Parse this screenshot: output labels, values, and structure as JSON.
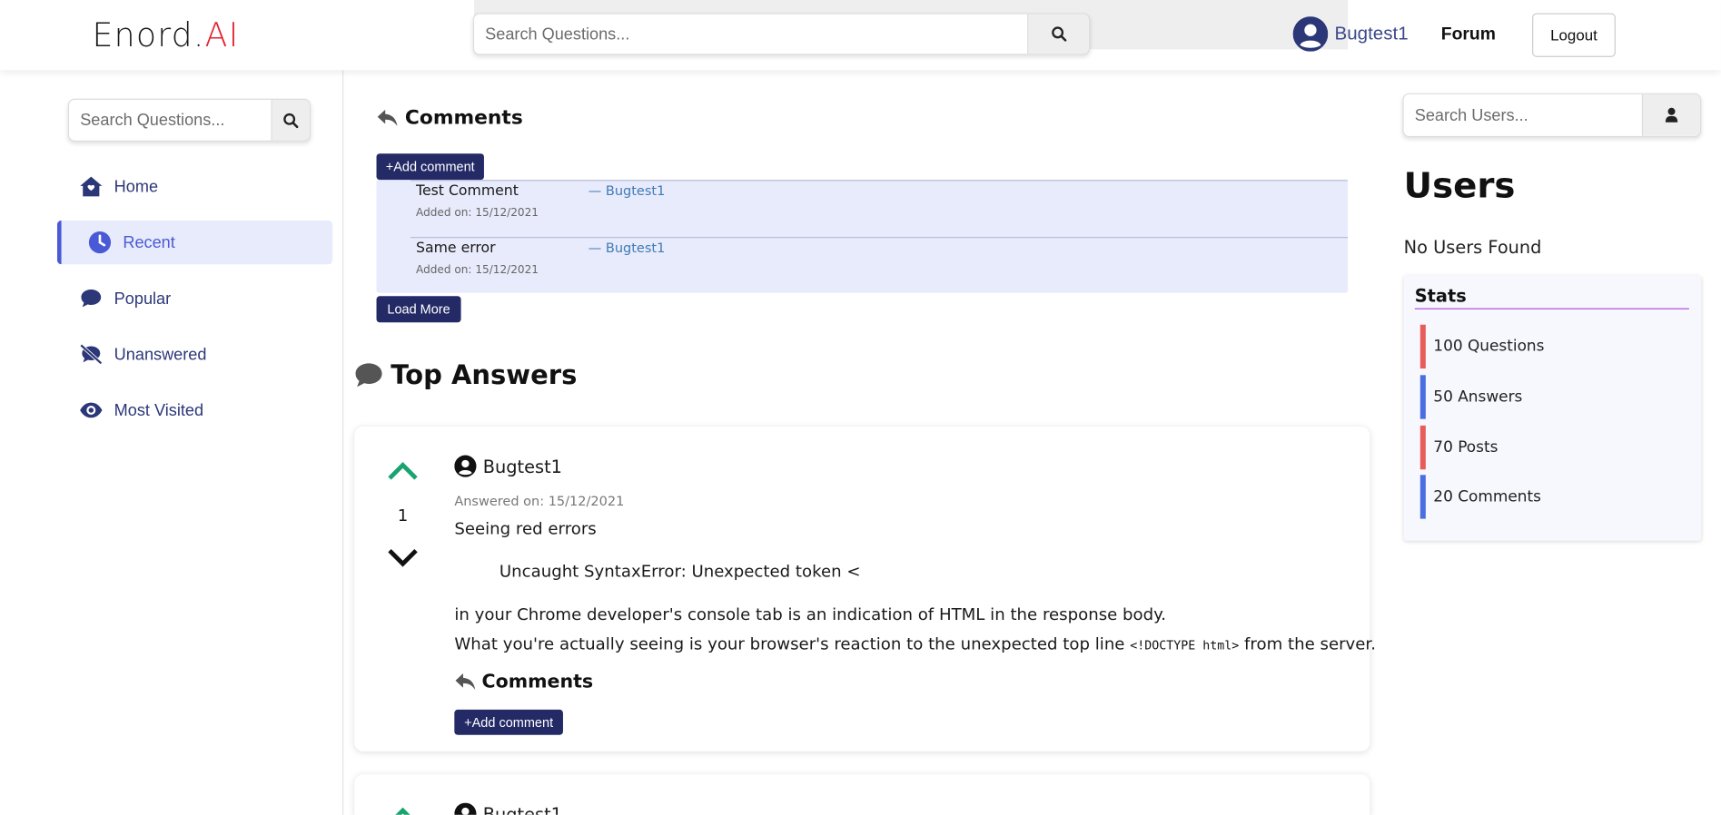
{
  "header": {
    "logo_part1": "Enord.",
    "logo_part2": "AI",
    "search_placeholder": "Search Questions...",
    "username": "Bugtest1",
    "forum_label": "Forum",
    "logout_label": "Logout"
  },
  "left_sidebar": {
    "search_placeholder": "Search Questions...",
    "nav": [
      {
        "label": "Home",
        "icon": "home-icon",
        "active": false
      },
      {
        "label": "Recent",
        "icon": "clock-icon",
        "active": true
      },
      {
        "label": "Popular",
        "icon": "comment-icon",
        "active": false
      },
      {
        "label": "Unanswered",
        "icon": "comment-slash-icon",
        "active": false
      },
      {
        "label": "Most Visited",
        "icon": "eye-icon",
        "active": false
      }
    ]
  },
  "main": {
    "comments_title": "Comments",
    "add_comment_label": "+Add comment",
    "comments": [
      {
        "text": "Test Comment",
        "date": "Added on: 15/12/2021",
        "author": "— Bugtest1"
      },
      {
        "text": "Same error",
        "date": "Added on: 15/12/2021",
        "author": "— Bugtest1"
      }
    ],
    "load_more_label": "Load More",
    "top_answers_title": "Top Answers",
    "answer": {
      "votes": "1",
      "user": "Bugtest1",
      "date": "Answered on: 15/12/2021",
      "line1": "Seeing red errors",
      "code_line": "Uncaught SyntaxError: Unexpected token <",
      "line3": "in your Chrome developer's console tab is an indication of HTML in the response body.",
      "line4_pre": "What you're actually seeing is your browser's reaction to the unexpected top line ",
      "line4_code": "<!DOCTYPE html>",
      "line4_post": " from the server.",
      "comments_title": "Comments",
      "add_comment_label": "+Add comment"
    },
    "answer2": {
      "user": "Bugtest1"
    }
  },
  "right_sidebar": {
    "search_placeholder": "Search Users...",
    "users_title": "Users",
    "no_users": "No Users Found",
    "stats_title": "Stats",
    "stats": [
      {
        "label": "100 Questions",
        "color": "#e85c5c"
      },
      {
        "label": "50 Answers",
        "color": "#4a6ee0"
      },
      {
        "label": "70 Posts",
        "color": "#e85c5c"
      },
      {
        "label": "20 Comments",
        "color": "#4a6ee0"
      }
    ]
  },
  "colors": {
    "accent": "#4a5ad6",
    "button_dark": "#242a66",
    "logo_red": "#e5202e",
    "vote_up": "#1aa36f"
  }
}
